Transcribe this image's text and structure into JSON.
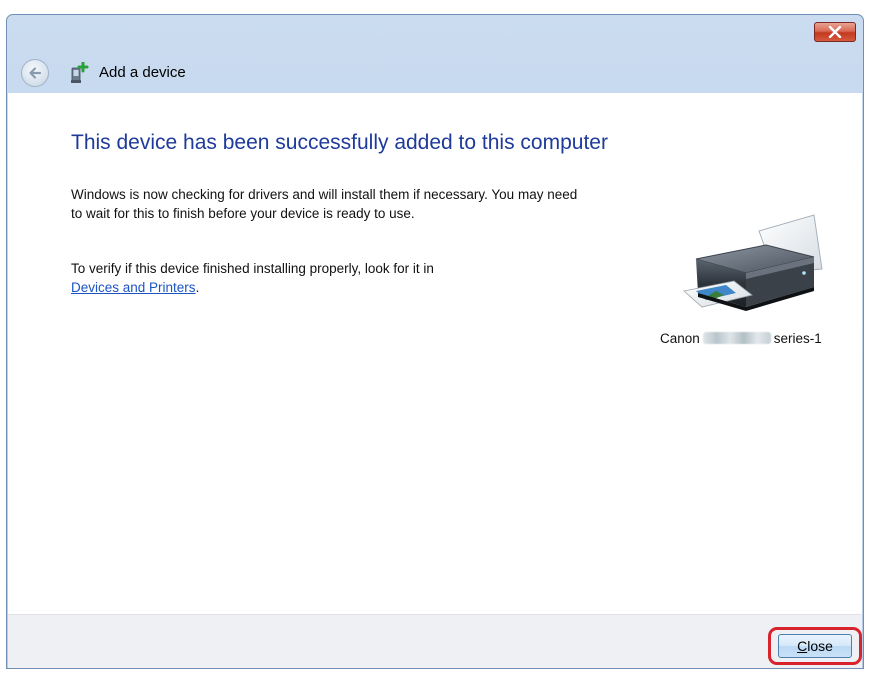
{
  "window": {
    "title_bar_close": "close-window"
  },
  "nav": {
    "title": "Add a device"
  },
  "main": {
    "heading": "This device has been successfully added to this computer",
    "paragraph1": "Windows is now checking for drivers and will install them if necessary. You may need to wait for this to finish before your device is ready to use.",
    "paragraph2_text": "To verify if this device finished installing properly, look for it in",
    "paragraph2_link": "Devices and Printers",
    "paragraph2_end": "."
  },
  "device": {
    "name_prefix": "Canon",
    "name_suffix": "series-1",
    "icon": "printer-icon"
  },
  "footer": {
    "close_mnemonic": "C",
    "close_rest": "lose"
  },
  "colors": {
    "heading": "#1e3a9a",
    "link": "#1c55c2",
    "highlight": "#d9232c",
    "close_window_button": "#c2391f"
  }
}
